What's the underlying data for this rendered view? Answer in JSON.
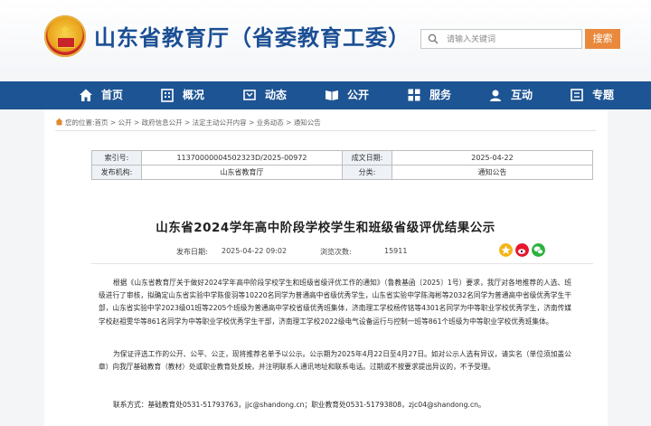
{
  "header": {
    "site_title": "山东省教育厅（省委教育工委）",
    "search_placeholder": "请输入关键词",
    "search_button": "搜索",
    "accent_color": "#1d5493",
    "search_button_color": "#e8893d"
  },
  "nav": {
    "items": [
      {
        "label": "首页",
        "icon": "home-icon"
      },
      {
        "label": "概况",
        "icon": "building-icon"
      },
      {
        "label": "动态",
        "icon": "news-icon"
      },
      {
        "label": "公开",
        "icon": "book-icon"
      },
      {
        "label": "服务",
        "icon": "grid-icon"
      },
      {
        "label": "互动",
        "icon": "chat-icon"
      },
      {
        "label": "专题",
        "icon": "topic-icon"
      }
    ]
  },
  "breadcrumb": {
    "prefix": "您的位置:",
    "trail": "首页 > 公开 > 政府信息公开 > 法定主动公开内容 > 业务动态 > 通知公告"
  },
  "meta": {
    "index_label": "索引号:",
    "index_value": "11370000004502323D/2025-00972",
    "date_label": "成文日期:",
    "date_value": "2025-04-22",
    "issuer_label": "发布机构:",
    "issuer_value": "山东省教育厅",
    "category_label": "分类:",
    "category_value": "通知公告"
  },
  "article": {
    "title": "山东省2024学年高中阶段学校学生和班级省级评优结果公示",
    "published_label": "发布日期:",
    "published_value": "2025-04-22 09:02",
    "views_label": "浏览次数:",
    "views_value": "15911",
    "paragraph1": "根据《山东省教育厅关于做好2024学年高中阶段学校学生和班级省级评优工作的通知》（鲁教基函〔2025〕1号）要求，我厅对各地推荐的人选、班级进行了审核，拟确定山东省实验中学陈俊羽等10220名同学为普通高中省级优秀学生，山东省实验中学陈海彬等2032名同学为普通高中省级优秀学生干部，山东省实验中学2023级01班等2205个班级为普通高中学校省级优秀班集体，济南理工学校杨传铭等4301名同学为中等职业学校优秀学生，济南传媒学校赵祖雯华等861名同学为中等职业学校优秀学生干部，济南理工学校2022级电气设备运行与控制一班等861个班级为中等职业学校优秀班集体。",
    "paragraph2": "为保证评选工作的公开、公平、公正，现将推荐名单予以公示。公示期为2025年4月22日至4月27日。如对公示人选有异议，请实名（单位须加盖公章）向我厅基础教育（教材）处或职业教育处反映，并注明联系人通讯地址和联系电话。过期或不按要求提出异议的，不予受理。",
    "contact": "联系方式：基础教育处0531-51793763，jjc@shandong.cn；职业教育处0531-51793808，zjc04@shandong.cn。"
  }
}
